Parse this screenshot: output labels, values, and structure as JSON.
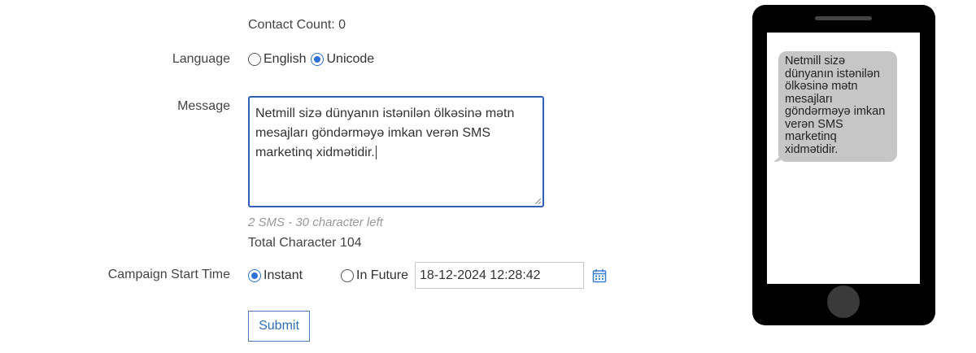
{
  "contact_count": "Contact Count: 0",
  "language": {
    "label": "Language",
    "options": [
      "English",
      "Unicode"
    ],
    "selected": "Unicode"
  },
  "message": {
    "label": "Message",
    "value": "Netmill sizə dünyanın istənilən ölkəsinə mətn mesajları göndərməyə imkan verən SMS marketinq xidmətidir."
  },
  "sms_info": "2 SMS - 30 character left",
  "total_character": "Total Character 104",
  "campaign": {
    "label": "Campaign Start Time",
    "options": [
      "Instant",
      "In Future"
    ],
    "selected": "Instant",
    "datetime": "18-12-2024 12:28:42"
  },
  "submit_label": "Submit",
  "preview_text": "Netmill sizə dünyanın istənilən ölkəsinə mətn mesajları göndərməyə imkan verən SMS marketinq xidmətidir.",
  "colors": {
    "accent": "#2f6fd6",
    "bubble": "#c6c6c6",
    "phone": "#000000"
  }
}
